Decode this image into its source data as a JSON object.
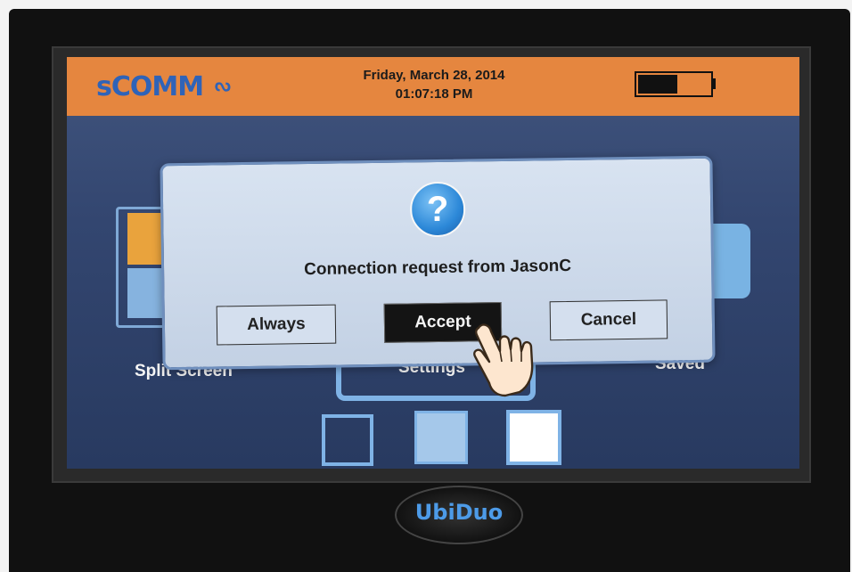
{
  "device": {
    "badge_text": "UbiDuo"
  },
  "header": {
    "logo": "sCOMM",
    "date": "Friday, March 28, 2014",
    "time": "01:07:18 PM",
    "battery_level": 0.55
  },
  "menu": {
    "split_screen_label": "Split Screen",
    "settings_label": "Settings",
    "saved_label": "Saved"
  },
  "dialog": {
    "icon": "question-icon",
    "message": "Connection request from JasonC",
    "buttons": {
      "always": "Always",
      "accept": "Accept",
      "cancel": "Cancel"
    },
    "selected": "accept"
  },
  "colors": {
    "header_bg": "#e5863f",
    "logo": "#2f63b8",
    "dialog_bg": "#d4dfee",
    "accept_bg": "#141414"
  }
}
